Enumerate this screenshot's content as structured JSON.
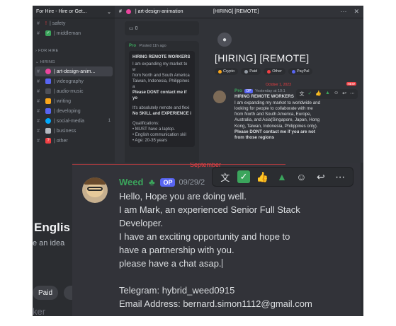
{
  "sidebar": {
    "server_name": "For Hire - Hire or Get...",
    "channels_top": [
      {
        "emoji": "!",
        "emoji_color": "#f23f43",
        "label": "| safety"
      },
      {
        "emoji": "✓",
        "emoji_color": "#3ba55c",
        "label": "| middleman"
      }
    ],
    "category_for_hire": "FOR HIRE",
    "category_hiring": "HIRING",
    "channels": [
      {
        "emoji_color": "#eb459e",
        "label": "| art-design-anim...",
        "active": true
      },
      {
        "emoji_color": "#5865f2",
        "label": "| videography"
      },
      {
        "emoji_color": "#4e5058",
        "label": "| audio-music"
      },
      {
        "emoji_color": "#faa61a",
        "label": "| writing"
      },
      {
        "emoji_color": "#5865f2",
        "label": "| developing"
      },
      {
        "emoji_color": "#00a8fc",
        "label": "| social-media",
        "count": "1"
      },
      {
        "emoji_color": "#b5bac1",
        "label": "| business"
      },
      {
        "emoji_color": "#f23f43",
        "label": "| other"
      }
    ]
  },
  "channel": {
    "name": "| art-design-animation",
    "reply_count": "0",
    "post_author": "Pro",
    "post_meta": "Posted 11h ago",
    "post_title": "HIRING REMOTE WORKERS",
    "post_lines": [
      "I am expanding my market to w",
      "from North and South America",
      "Taiwan, Indonesia, Philippines a",
      "Please DONT contact me if yo",
      "",
      "It's absolutely remote and flexi",
      "No SKILL and EXPERIENCE i",
      "",
      "Qualifications:",
      "• MUST have a laptop.",
      "• English communication skil",
      "• Age: 20-35 years"
    ]
  },
  "thread": {
    "header": "[HIRING] [REMOTE]",
    "title": "[HIRING] [REMOTE]",
    "tags": [
      {
        "label": "Crypto",
        "color": "#faa61a"
      },
      {
        "label": "Paid",
        "color": "#949ba4"
      },
      {
        "label": "Other",
        "color": "#f23f43"
      },
      {
        "label": "PayPal",
        "color": "#5865f2"
      }
    ],
    "date_divider": "October 1, 2023",
    "new_badge": "NEW",
    "msg_author": "Pro",
    "msg_op": "OP",
    "msg_time": "Yesterday at 10:1",
    "msg_title": "HIRING REMOTE WORKERS",
    "msg_lines": [
      "I am expanding my market to worldwide and",
      "looking for people to collaborate with me",
      "from North and South America, Europe,",
      "Australia, and Asia(Singapore, Japan, Hong",
      "Kong, Taiwan, Indonesia, Philippines only).",
      "Please DONT contact me if you are not",
      "from those regions"
    ]
  },
  "zoom": {
    "left_heading": "Englis",
    "left_subtext": "e an idea",
    "paid_button": "Paid",
    "left_bottom_text": "ker",
    "date_divider": "September",
    "author": "Weed",
    "op_badge": "OP",
    "timestamp": "09/29/2",
    "lines": [
      "Hello, Hope you are doing well.",
      "I am Mark, an experienced Senior Full Stack",
      "Developer.",
      "I have an exciting opportunity and hope to",
      "have a partnership with you.",
      "please have a chat asap.",
      "",
      "Telegram: hybrid_weed0915",
      "Email Address: bernard.simon1112@gmail.com"
    ]
  },
  "toolbar_icons": [
    "translate-icon",
    "check-reaction-icon",
    "thumbs-up-icon",
    "tree-icon",
    "add-reaction-icon",
    "reply-icon",
    "more-icon"
  ]
}
